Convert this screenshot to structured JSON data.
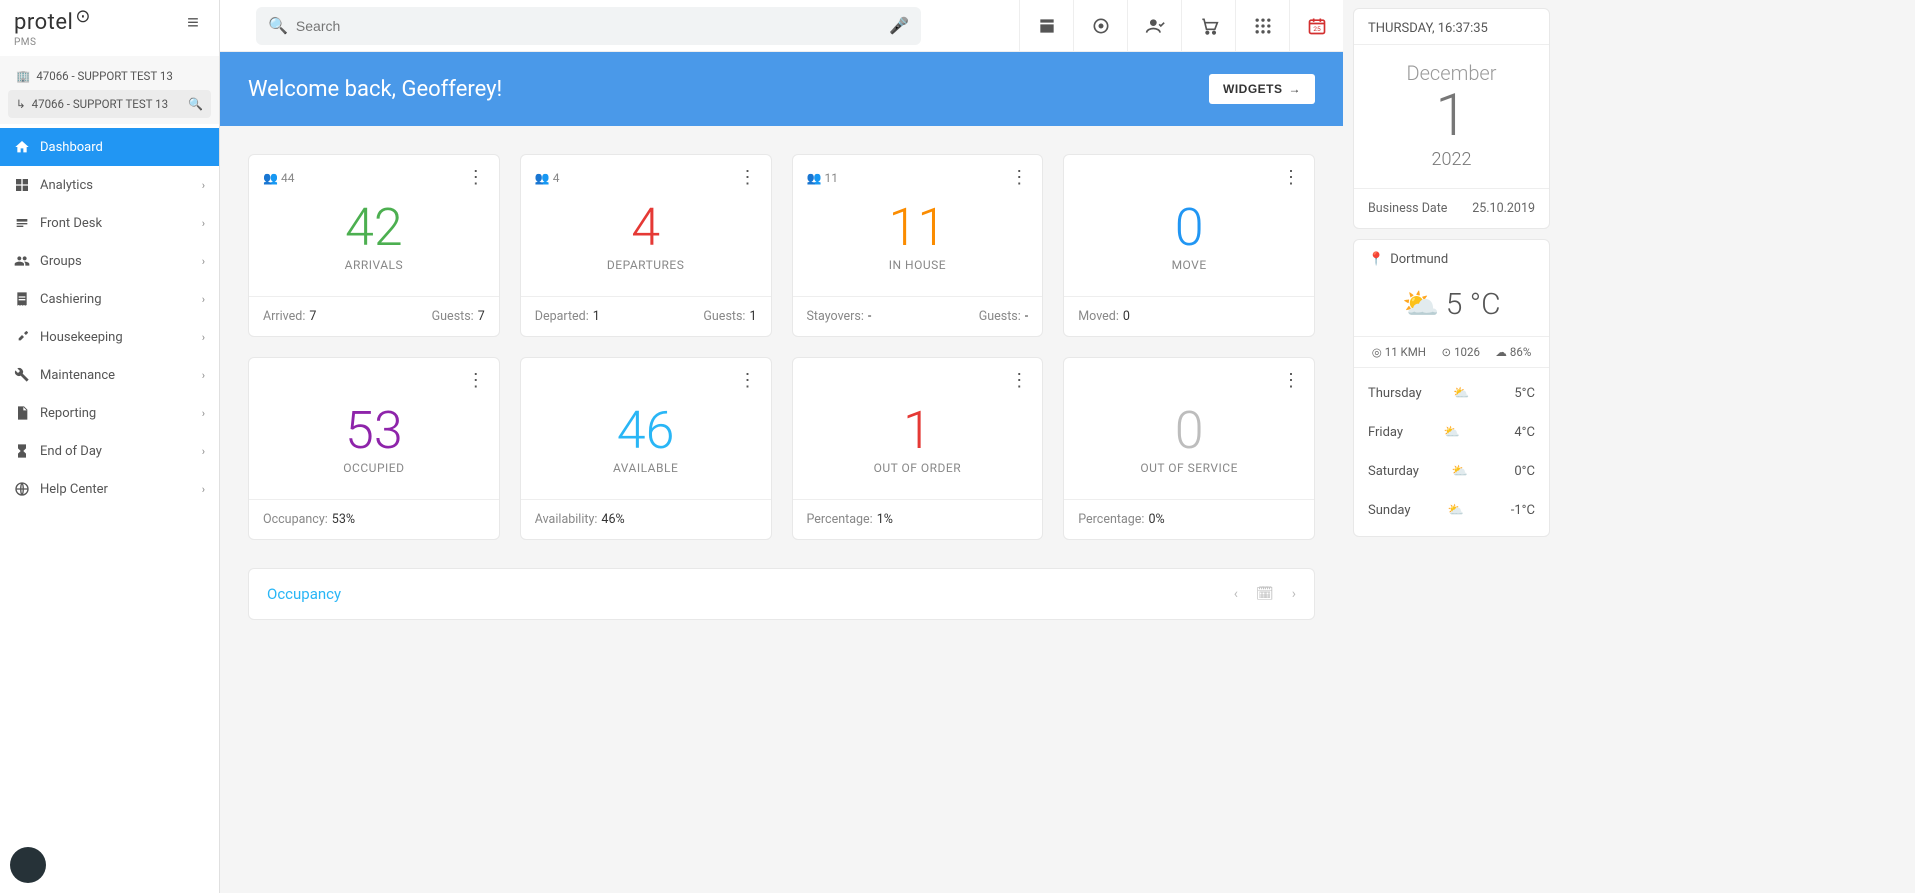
{
  "brand": {
    "name": "protel",
    "sub": "PMS"
  },
  "hotels": [
    {
      "label": "47066 - SUPPORT TEST 13"
    },
    {
      "label": "47066 - SUPPORT TEST 13"
    }
  ],
  "nav": [
    {
      "label": "Dashboard"
    },
    {
      "label": "Analytics"
    },
    {
      "label": "Front Desk"
    },
    {
      "label": "Groups"
    },
    {
      "label": "Cashiering"
    },
    {
      "label": "Housekeeping"
    },
    {
      "label": "Maintenance"
    },
    {
      "label": "Reporting"
    },
    {
      "label": "End of Day"
    },
    {
      "label": "Help Center"
    }
  ],
  "search": {
    "placeholder": "Search"
  },
  "hero": {
    "greeting": "Welcome back, Geofferey!",
    "widgets_btn": "WIDGETS"
  },
  "cards": {
    "arrivals": {
      "count": "44",
      "big": "42",
      "label": "ARRIVALS",
      "foot_l_k": "Arrived:",
      "foot_l_v": "7",
      "foot_r_k": "Guests:",
      "foot_r_v": "7"
    },
    "departures": {
      "count": "4",
      "big": "4",
      "label": "DEPARTURES",
      "foot_l_k": "Departed:",
      "foot_l_v": "1",
      "foot_r_k": "Guests:",
      "foot_r_v": "1"
    },
    "inhouse": {
      "count": "11",
      "big": "11",
      "label": "IN HOUSE",
      "foot_l_k": "Stayovers:",
      "foot_l_v": "-",
      "foot_r_k": "Guests:",
      "foot_r_v": "-"
    },
    "move": {
      "big": "0",
      "label": "MOVE",
      "foot_l_k": "Moved:",
      "foot_l_v": "0"
    },
    "occupied": {
      "big": "53",
      "label": "OCCUPIED",
      "foot_l_k": "Occupancy:",
      "foot_l_v": "53%"
    },
    "available": {
      "big": "46",
      "label": "AVAILABLE",
      "foot_l_k": "Availability:",
      "foot_l_v": "46%"
    },
    "ooo": {
      "big": "1",
      "label": "OUT OF ORDER",
      "foot_l_k": "Percentage:",
      "foot_l_v": "1%"
    },
    "oos": {
      "big": "0",
      "label": "OUT OF SERVICE",
      "foot_l_k": "Percentage:",
      "foot_l_v": "0%"
    }
  },
  "occupancy_panel": {
    "title": "Occupancy"
  },
  "right": {
    "datetime": "THURSDAY, 16:37:35",
    "month": "December",
    "day": "1",
    "year": "2022",
    "bizdate_label": "Business Date",
    "bizdate_value": "25.10.2019",
    "location": "Dortmund",
    "temp": "5 °C",
    "wind": "11 KMH",
    "pressure": "1026",
    "humidity": "86%",
    "forecast": [
      {
        "day": "Thursday",
        "temp": "5°C"
      },
      {
        "day": "Friday",
        "temp": "4°C"
      },
      {
        "day": "Saturday",
        "temp": "0°C"
      },
      {
        "day": "Sunday",
        "temp": "-1°C"
      }
    ]
  }
}
